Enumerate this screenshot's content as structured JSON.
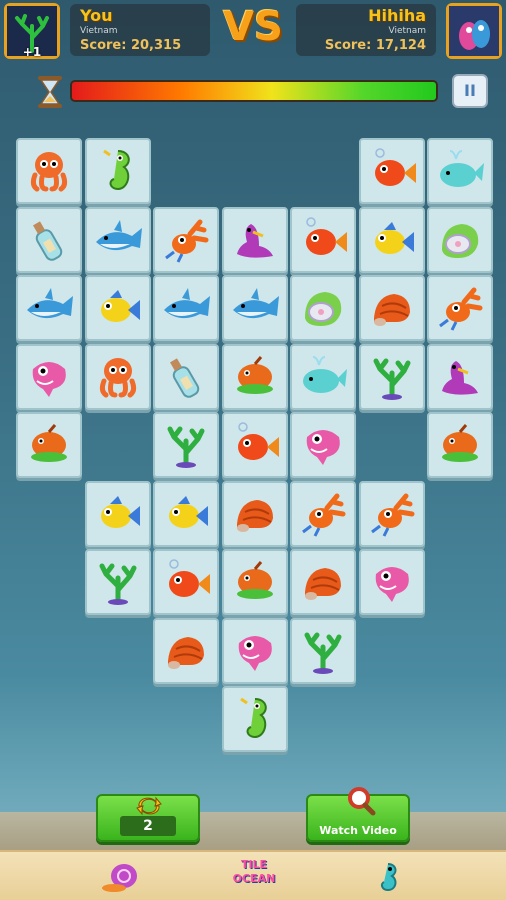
{
  "player1": {
    "name": "You",
    "country": "Vietnam",
    "score": "Score: 20,315",
    "badge": "+1"
  },
  "player2": {
    "name": "Hihiha",
    "country": "Vietnam",
    "score": "Score: 17,124"
  },
  "vs_text": "VS",
  "timer": {
    "fraction": 1.0
  },
  "pause_label": "II",
  "board": {
    "rows": [
      [
        "octopus",
        "seahorse",
        "",
        "",
        "",
        "goldfish",
        "whale"
      ],
      [
        "bottle",
        "shark",
        "crab",
        "seal",
        "goldfish",
        "clownfish",
        "shell"
      ],
      [
        "shark",
        "clownfish",
        "shark",
        "shark",
        "shell",
        "hermit",
        "crab"
      ],
      [
        "pink-fish",
        "octopus",
        "bottle",
        "red-fish",
        "whale",
        "coral",
        "seal"
      ],
      [
        "red-fish",
        "",
        "coral",
        "goldfish",
        "pink-fish",
        "",
        "red-fish"
      ],
      [
        "",
        "clownfish",
        "clownfish",
        "hermit",
        "crab",
        "crab",
        ""
      ],
      [
        "",
        "coral",
        "goldfish",
        "red-fish",
        "hermit",
        "pink-fish",
        ""
      ],
      [
        "",
        "",
        "hermit",
        "pink-fish",
        "coral",
        "",
        ""
      ],
      [
        "",
        "",
        "",
        "seahorse",
        "",
        "",
        ""
      ]
    ]
  },
  "shuffle": {
    "count": "2"
  },
  "watch_video": {
    "label": "Watch Video"
  },
  "nav": {
    "logo_text": "TILE OCEAN"
  },
  "colors": {
    "accent": "#f7a11a",
    "button_green": "#3ab41c",
    "tile": "#cfe6ea"
  }
}
